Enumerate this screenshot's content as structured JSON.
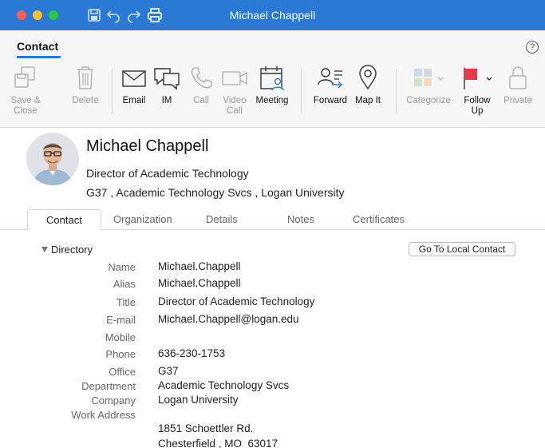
{
  "window": {
    "title": "Michael Chappell",
    "title_icons": [
      "save-icon",
      "undo-icon",
      "redo-icon",
      "print-icon"
    ]
  },
  "ribbon": {
    "tab_label": "Contact",
    "help_label": "?",
    "buttons": [
      {
        "name": "save-close",
        "label": "Save & Close",
        "icon": "save-close-icon",
        "enabled": false
      },
      {
        "name": "delete",
        "label": "Delete",
        "icon": "trash-icon",
        "enabled": false
      },
      {
        "name": "email",
        "label": "Email",
        "icon": "envelope-icon",
        "enabled": true
      },
      {
        "name": "im",
        "label": "IM",
        "icon": "chat-bubbles-icon",
        "enabled": true
      },
      {
        "name": "call",
        "label": "Call",
        "icon": "phone-icon",
        "enabled": false
      },
      {
        "name": "video-call",
        "label": "Video Call",
        "icon": "video-camera-icon",
        "enabled": false
      },
      {
        "name": "meeting",
        "label": "Meeting",
        "icon": "calendar-person-icon",
        "enabled": true
      },
      {
        "name": "forward",
        "label": "Forward",
        "icon": "forward-contact-icon",
        "enabled": true
      },
      {
        "name": "map-it",
        "label": "Map It",
        "icon": "map-pin-icon",
        "enabled": true
      },
      {
        "name": "categorize",
        "label": "Categorize",
        "icon": "category-grid-icon",
        "enabled": false
      },
      {
        "name": "follow-up",
        "label": "Follow Up",
        "icon": "red-flag-icon",
        "enabled": true
      },
      {
        "name": "private",
        "label": "Private",
        "icon": "lock-icon",
        "enabled": false
      }
    ]
  },
  "contact": {
    "name": "Michael Chappell",
    "job_title": "Director of Academic Technology",
    "office": "G37",
    "department": "Academic Technology Svcs",
    "company": "Logan University",
    "separator": " , "
  },
  "tabs": [
    "Contact",
    "Organization",
    "Details",
    "Notes",
    "Certificates"
  ],
  "active_tab": "Contact",
  "directory": {
    "heading": "Directory",
    "goto_button": "Go To Local Contact",
    "fields": [
      {
        "label": "Name",
        "value": "Michael.Chappell"
      },
      {
        "label": "Alias",
        "value": "Michael.Chappell"
      },
      {
        "label": "Title",
        "value": "Director of Academic Technology"
      },
      {
        "label": "E-mail",
        "value": "Michael.Chappell@logan.edu"
      },
      {
        "label": "Mobile",
        "value": ""
      },
      {
        "label": "Phone",
        "value": "636-230-1753"
      },
      {
        "label": "Office",
        "value": "G37"
      },
      {
        "label": "Department",
        "value": "Academic Technology Svcs"
      },
      {
        "label": "Company",
        "value": "Logan University"
      },
      {
        "label": "Work Address",
        "value": ""
      }
    ],
    "address": {
      "street": "1851 Schoettler Rd.",
      "city_line": "Chesterfield , MO  63017"
    }
  },
  "colors": {
    "titlebar": "#2a79d4",
    "accent": "#2a79d4",
    "follow_up_flag": "#e8394b"
  }
}
